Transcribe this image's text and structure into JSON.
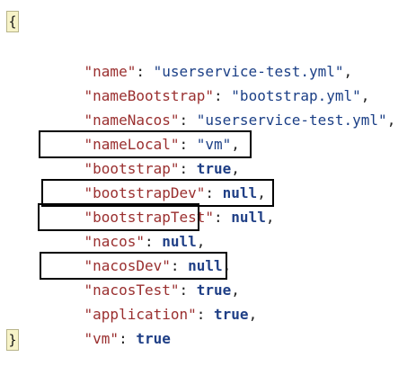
{
  "editor": {
    "open_brace": "{",
    "close_brace": "}",
    "lines": [
      {
        "key": "\"name\"",
        "sep": ": ",
        "value": "\"userservice-test.yml\"",
        "value_type": "string",
        "comma": ","
      },
      {
        "key": "\"nameBootstrap\"",
        "sep": ": ",
        "value": "\"bootstrap.yml\"",
        "value_type": "string",
        "comma": ","
      },
      {
        "key": "\"nameNacos\"",
        "sep": ": ",
        "value": "\"userservice-test.yml\"",
        "value_type": "string",
        "comma": ","
      },
      {
        "key": "\"nameLocal\"",
        "sep": ": ",
        "value": "\"vm\"",
        "value_type": "string",
        "comma": ","
      },
      {
        "key": "\"bootstrap\"",
        "sep": ": ",
        "value": "true",
        "value_type": "keyword",
        "comma": ","
      },
      {
        "key": "\"bootstrapDev\"",
        "sep": ": ",
        "value": "null",
        "value_type": "keyword",
        "comma": ","
      },
      {
        "key": "\"bootstrapTest\"",
        "sep": ": ",
        "value": "null",
        "value_type": "keyword",
        "comma": ","
      },
      {
        "key": "\"nacos\"",
        "sep": ": ",
        "value": "null",
        "value_type": "keyword",
        "comma": ","
      },
      {
        "key": "\"nacosDev\"",
        "sep": ": ",
        "value": "null",
        "value_type": "keyword",
        "comma": ","
      },
      {
        "key": "\"nacosTest\"",
        "sep": ": ",
        "value": "true",
        "value_type": "keyword",
        "comma": ","
      },
      {
        "key": "\"application\"",
        "sep": ": ",
        "value": "true",
        "value_type": "keyword",
        "comma": ","
      },
      {
        "key": "\"vm\"",
        "sep": ": ",
        "value": "true",
        "value_type": "keyword",
        "comma": ""
      }
    ]
  },
  "colors": {
    "key": "#9a2f2f",
    "string": "#1b3f86",
    "keyword": "#1f3f86",
    "highlight_box": "#000000",
    "brace_bg": "#f7f3c8"
  }
}
